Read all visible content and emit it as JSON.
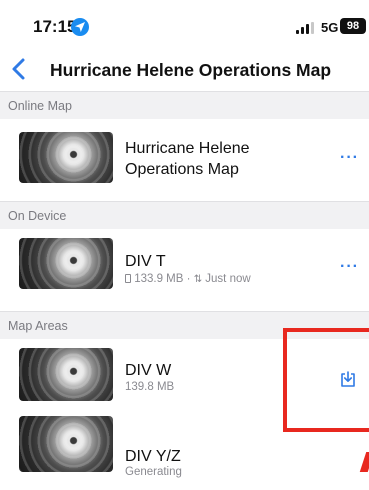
{
  "status_bar": {
    "time": "17:15",
    "network": "5G",
    "battery": "98"
  },
  "nav": {
    "title": "Hurricane Helene Operations Map"
  },
  "sections": {
    "online": "Online Map",
    "on_device": "On Device",
    "map_areas": "Map Areas"
  },
  "online_map": {
    "title_line1": "Hurricane Helene",
    "title_line2": "Operations Map",
    "more": "···"
  },
  "on_device": {
    "title": "DIV T",
    "size": "133.9 MB",
    "separator": "·",
    "sync": "Just now",
    "more": "···"
  },
  "map_areas": [
    {
      "title": "DIV W",
      "subtitle": "139.8 MB"
    },
    {
      "title": "DIV Y/Z",
      "subtitle": "Generating"
    }
  ],
  "colors": {
    "accent": "#2f7ae5",
    "annotation": "#e8281f",
    "section_bg": "#f1f1f3"
  },
  "icons": {
    "back": "chevron-left-icon",
    "location": "location-arrow-icon",
    "download": "download-icon",
    "storage": "storage-icon",
    "sync": "sync-arrows-icon"
  }
}
